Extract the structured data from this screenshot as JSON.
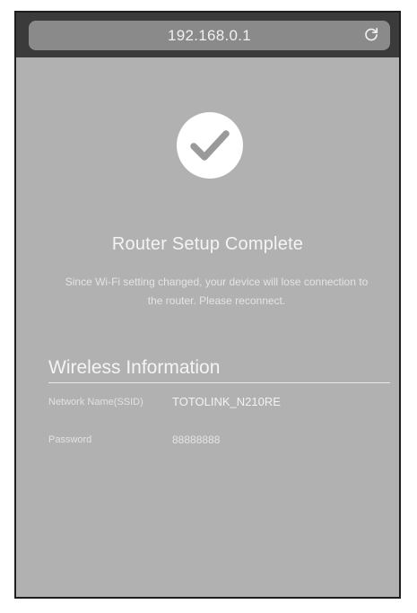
{
  "browser": {
    "address": "192.168.0.1",
    "reload_icon": "reload-icon"
  },
  "status": {
    "icon": "checkmark-circle-icon",
    "title": "Router Setup Complete",
    "message": "Since Wi-Fi setting changed, your device will lose connection to the router. Please reconnect."
  },
  "wireless_info": {
    "title": "Wireless Information",
    "network_label": "Network Name(SSID)",
    "network_value": "TOTOLINK_N210RE",
    "password_label": "Password",
    "password_value": "88888888"
  },
  "colors": {
    "content_background": "#b1b1b1",
    "browser_bar": "#3b3b3b",
    "address_pill": "#8a8a8a"
  }
}
